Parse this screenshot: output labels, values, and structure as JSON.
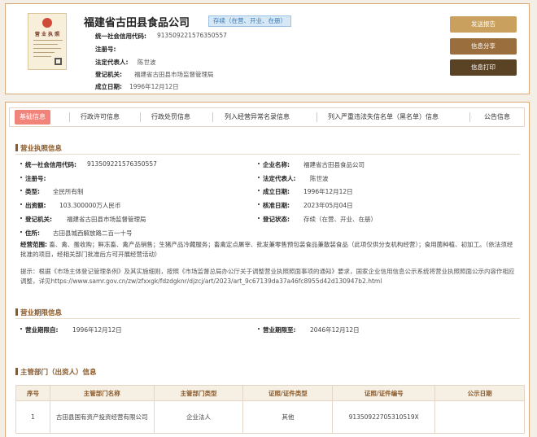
{
  "header": {
    "company_name": "福建省古田县食品公司",
    "status": "存续（在营、开业、在册）",
    "license_thumb_title": "营 业 执 照",
    "rows": [
      {
        "label": "统一社会信用代码:",
        "value": "913509221576350557"
      },
      {
        "label": "注册号:",
        "value": ""
      },
      {
        "label": "法定代表人:",
        "value": "陈世波"
      },
      {
        "label": "登记机关:",
        "value": "福建省古田县市场监督管理局"
      },
      {
        "label": "成立日期:",
        "value": "1996年12月12日"
      }
    ],
    "buttons": {
      "report": "发送报告",
      "share": "信息分享",
      "print": "信息打印"
    }
  },
  "tabs": [
    "基础信息",
    "行政许可信息",
    "行政处罚信息",
    "列入经营异常名录信息",
    "列入严重违法失信名单（黑名单）信息",
    "公告信息"
  ],
  "active_tab": 0,
  "license_section": {
    "title": "营业执照信息",
    "left": [
      {
        "label": "统一社会信用代码:",
        "value": "913509221576350557"
      },
      {
        "label": "注册号:",
        "value": ""
      },
      {
        "label": "类型:",
        "value": "全民所有制"
      },
      {
        "label": "出资额:",
        "value": "103.300000万人民币"
      },
      {
        "label": "登记机关:",
        "value": "福建省古田县市场监督管理局"
      },
      {
        "label": "住所:",
        "value": "古田县城西解放路二百一十号"
      }
    ],
    "right": [
      {
        "label": "企业名称:",
        "value": "福建省古田县食品公司"
      },
      {
        "label": "法定代表人:",
        "value": "陈世波"
      },
      {
        "label": "成立日期:",
        "value": "1996年12月12日"
      },
      {
        "label": "核准日期:",
        "value": "2023年05月04日"
      },
      {
        "label": "登记状态:",
        "value": "存续（在营、开业、在册）"
      }
    ],
    "scope_label": "经营范围:",
    "scope_value": "畜、禽、蛋收购；鲜冻畜、禽产品销售；生猪产品冷藏服务；畜禽定点屠宰、批发兼零售预包装食品兼散装食品（此项仅供分支机构经营）；食用菌种植、初加工。（依法须经批准的项目，经相关部门批准后方可开展经营活动）",
    "note": "提示：根据《市场主体登记管理条例》及其实施细则，按照《市场监督总局办公厅关于调整营业执照照面事项的通知》要求，国家企业信用信息公示系统将营业执照照面公示内容作相应调整，详见https://www.samr.gov.cn/zw/zfxxgk/fdzdgknr/djzcj/art/2023/art_9c67139da37a46fc8955d42d130947b2.html"
  },
  "term_section": {
    "title": "营业期限信息",
    "from_label": "营业期限自:",
    "from_value": "1996年12月12日",
    "to_label": "营业期限至:",
    "to_value": "2046年12月12日"
  },
  "investor_section": {
    "title": "主管部门（出资人）信息",
    "columns": [
      "序号",
      "主管部门名称",
      "主管部门类型",
      "证照/证件类型",
      "证照/证件编号",
      "公示日期"
    ],
    "rows": [
      [
        "1",
        "古田县国有资产投资经营有限公司",
        "企业法人",
        "其他",
        "91350922705310519X",
        ""
      ]
    ]
  },
  "colors": {
    "accent": "#8b5a2b",
    "tab_active": "#f1837a",
    "status_bg": "#d6e7f6",
    "border": "#d8a878"
  }
}
